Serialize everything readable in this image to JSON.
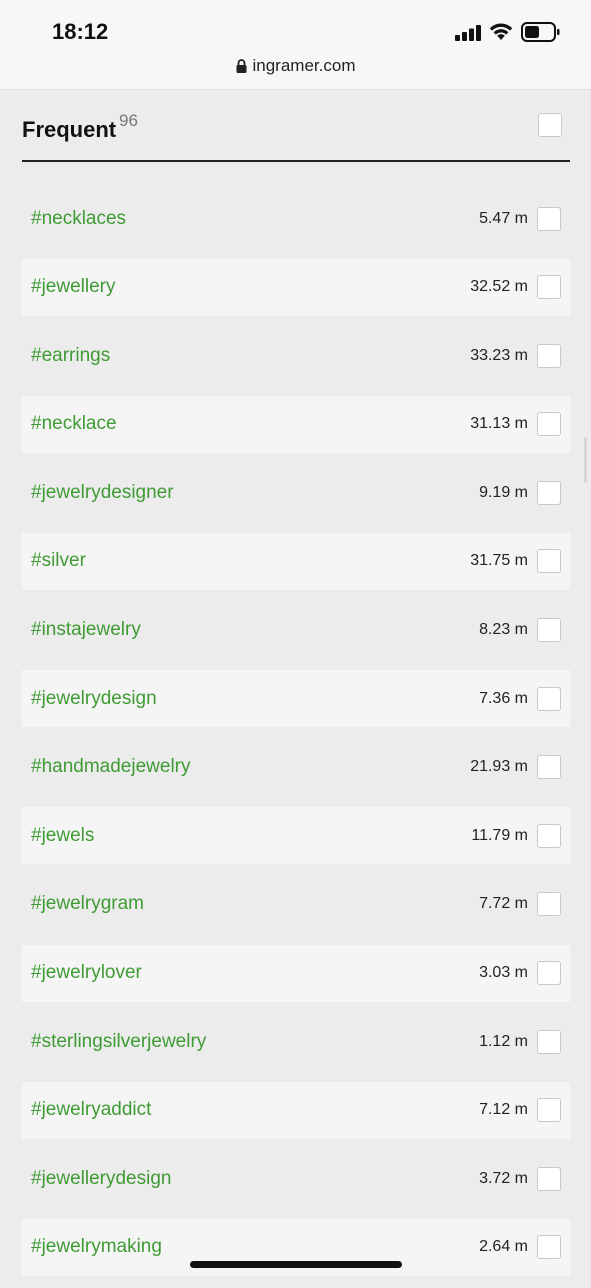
{
  "status_bar": {
    "time": "18:12",
    "url": "ingramer.com",
    "icons": [
      "signal-icon",
      "wifi-icon",
      "battery-icon",
      "lock-icon"
    ]
  },
  "section": {
    "title": "Frequent",
    "count": "96"
  },
  "colors": {
    "tag": "#3f9b34",
    "row_shade": "#f5f5f5",
    "background": "#ececec"
  },
  "hashtags": [
    {
      "tag": "#necklaces",
      "count": "5.47 m"
    },
    {
      "tag": "#jewellery",
      "count": "32.52 m"
    },
    {
      "tag": "#earrings",
      "count": "33.23 m"
    },
    {
      "tag": "#necklace",
      "count": "31.13 m"
    },
    {
      "tag": "#jewelrydesigner",
      "count": "9.19 m"
    },
    {
      "tag": "#silver",
      "count": "31.75 m"
    },
    {
      "tag": "#instajewelry",
      "count": "8.23 m"
    },
    {
      "tag": "#jewelrydesign",
      "count": "7.36 m"
    },
    {
      "tag": "#handmadejewelry",
      "count": "21.93 m"
    },
    {
      "tag": "#jewels",
      "count": "11.79 m"
    },
    {
      "tag": "#jewelrygram",
      "count": "7.72 m"
    },
    {
      "tag": "#jewelrylover",
      "count": "3.03 m"
    },
    {
      "tag": "#sterlingsilverjewelry",
      "count": "1.12 m"
    },
    {
      "tag": "#jewelryaddict",
      "count": "7.12 m"
    },
    {
      "tag": "#jewellerydesign",
      "count": "3.72 m"
    },
    {
      "tag": "#jewelrymaking",
      "count": "2.64 m"
    }
  ]
}
